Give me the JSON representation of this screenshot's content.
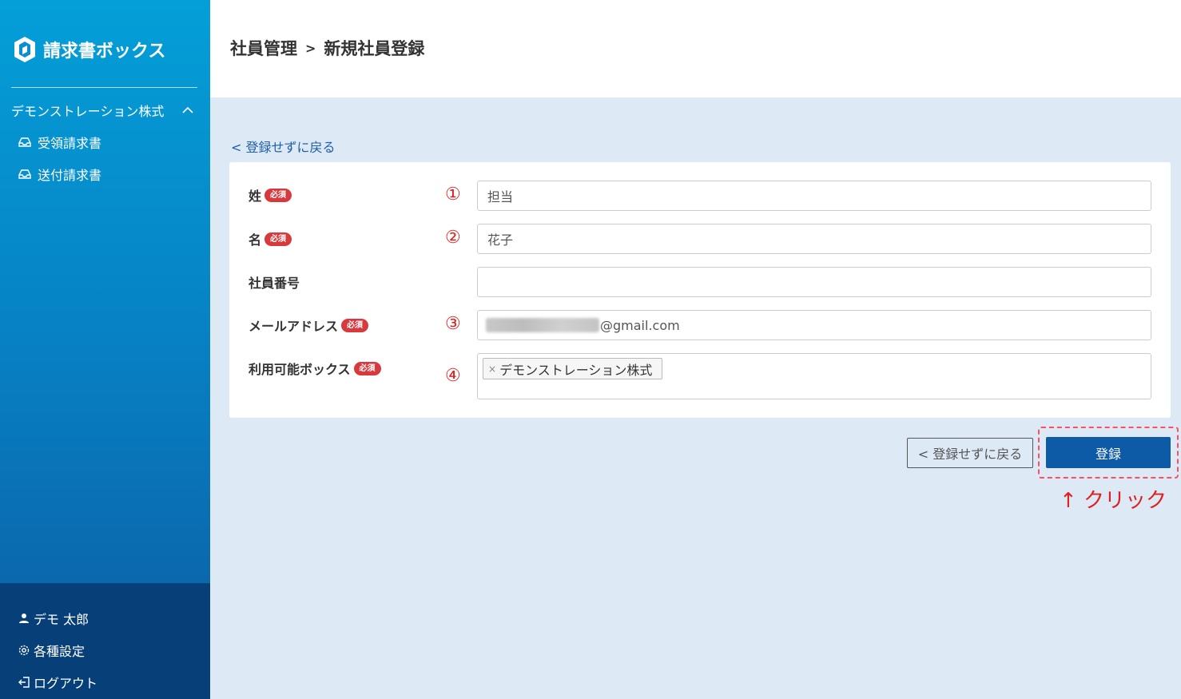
{
  "brand": {
    "name": "請求書ボックス"
  },
  "sidebar": {
    "company": "デモンストレーション株式",
    "items": [
      {
        "label": "受領請求書"
      },
      {
        "label": "送付請求書"
      }
    ],
    "bottom": [
      {
        "label": "デモ 太郎"
      },
      {
        "label": "各種設定"
      },
      {
        "label": "ログアウト"
      }
    ]
  },
  "header": {
    "parent": "社員管理",
    "separator": ">",
    "current": "新規社員登録"
  },
  "back_link": "< 登録せずに戻る",
  "form": {
    "required_badge": "必須",
    "last_name": {
      "label": "姓",
      "value": "担当",
      "marker": "①"
    },
    "first_name": {
      "label": "名",
      "value": "花子",
      "marker": "②"
    },
    "employee_number": {
      "label": "社員番号",
      "value": ""
    },
    "email": {
      "label": "メールアドレス",
      "value_suffix": "@gmail.com",
      "marker": "③"
    },
    "boxes": {
      "label": "利用可能ボックス",
      "tag": "デモンストレーション株式",
      "tag_remove": "×",
      "marker": "④"
    }
  },
  "actions": {
    "back_label": "< 登録せずに戻る",
    "submit_label": "登録"
  },
  "annotation": "↑ クリック"
}
